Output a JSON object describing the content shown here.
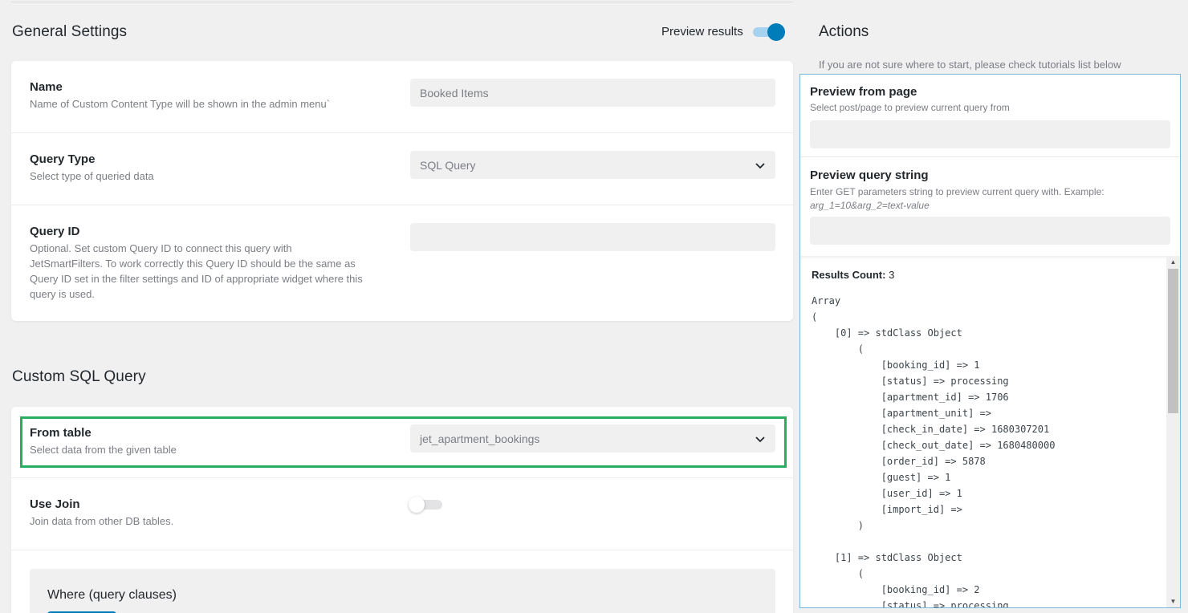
{
  "general": {
    "title": "General Settings",
    "preview_label": "Preview results",
    "preview_on": true
  },
  "name_row": {
    "label": "Name",
    "desc": "Name of Custom Content Type will be shown in the admin menu`",
    "value": "Booked Items"
  },
  "query_type_row": {
    "label": "Query Type",
    "desc": "Select type of queried data",
    "value": "SQL Query"
  },
  "query_id_row": {
    "label": "Query ID",
    "desc_lines": [
      "Optional. Set custom Query ID to connect this query with",
      "JetSmartFilters. To work correctly this Query ID should be the same as",
      "Query ID set in the filter settings and ID of appropriate widget where this",
      "query is used."
    ],
    "value": ""
  },
  "custom_sql": {
    "title": "Custom SQL Query",
    "from_table": {
      "label": "From table",
      "desc": "Select data from the given table",
      "value": "jet_apartment_bookings"
    },
    "use_join": {
      "label": "Use Join",
      "desc": "Join data from other DB tables.",
      "enabled": false
    },
    "where": {
      "title": "Where (query clauses)"
    }
  },
  "actions": {
    "title": "Actions",
    "hint": "If you are not sure where to start, please check tutorials list below",
    "preview_page": {
      "label": "Preview from page",
      "desc": "Select post/page to preview current query from",
      "value": ""
    },
    "preview_query": {
      "label": "Preview query string",
      "desc": "Enter GET parameters string to preview current query with. Example:",
      "example": "arg_1=10&arg_2=text-value",
      "value": ""
    },
    "results_label": "Results Count:",
    "results_count": "3",
    "code_lines": [
      "Array",
      "(",
      "    [0] => stdClass Object",
      "        (",
      "            [booking_id] => 1",
      "            [status] => processing",
      "            [apartment_id] => 1706",
      "            [apartment_unit] =>",
      "            [check_in_date] => 1680307201",
      "            [check_out_date] => 1680480000",
      "            [order_id] => 5878",
      "            [guest] => 1",
      "            [user_id] => 1",
      "            [import_id] =>",
      "        )",
      "",
      "    [1] => stdClass Object",
      "        (",
      "            [booking_id] => 2",
      "            [status] => processing"
    ]
  },
  "icons": {
    "dropdown": "chevron-down-icon",
    "scroll_up": "scroll-up-arrow-icon",
    "scroll_down": "scroll-down-arrow-icon"
  },
  "colors": {
    "accent": "#007cba",
    "highlight": "#27ae60",
    "background": "#f0f0f1"
  }
}
